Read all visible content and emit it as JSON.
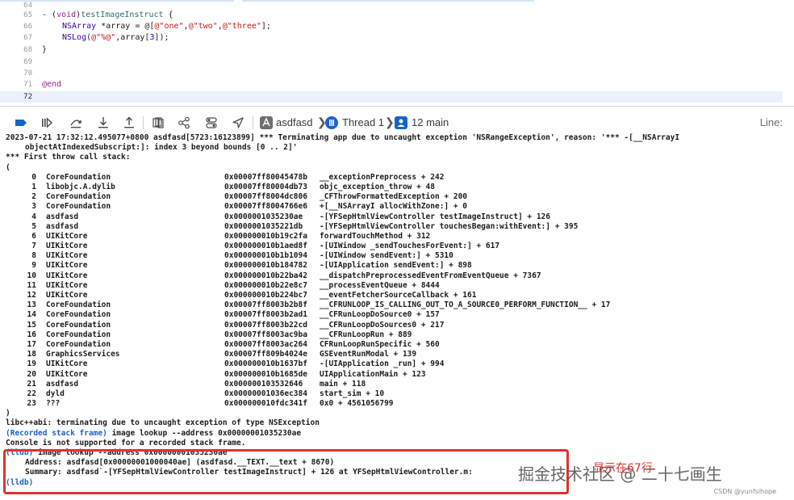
{
  "editor": {
    "lines": [
      {
        "num": "64"
      },
      {
        "num": "65"
      },
      {
        "num": "66"
      },
      {
        "num": "67"
      },
      {
        "num": "68"
      },
      {
        "num": "69"
      },
      {
        "num": "70"
      },
      {
        "num": "71"
      },
      {
        "num": "72"
      }
    ],
    "code": {
      "l65_dash": "- (",
      "l65_void": "void",
      "l65_rp": ")",
      "l65_fn": "testImageInstruct",
      "l65_brace": " {",
      "l66_type": "NSArray",
      "l66_mid": " *array = @[",
      "l66_s1": "@\"one\"",
      "l66_c1": ",",
      "l66_s2": "@\"two\"",
      "l66_c2": ",",
      "l66_s3": "@\"three\"",
      "l66_end": "];",
      "l67_fn": "NSLog",
      "l67_lp": "(",
      "l67_s": "@\"%@\"",
      "l67_mid": ",array[",
      "l67_num": "3",
      "l67_end": "]);",
      "l68": "}",
      "l71": "@end"
    }
  },
  "toolbar": {
    "target": "asdfasd",
    "thread": "Thread 1",
    "frame": "12 main",
    "line_label": "Line:",
    "icons": [
      "breakpoints-toggle-icon",
      "continue-icon",
      "step-over-icon",
      "step-into-icon",
      "step-out-icon",
      "debug-view-hierarchy-icon",
      "memory-graph-icon",
      "environment-overrides-icon",
      "simulate-location-icon"
    ]
  },
  "console": {
    "header1": "2023-07-21 17:32:12.495077+0800 asdfasd[5723:16123899] *** Terminating app due to uncaught exception 'NSRangeException', reason: '*** -[__NSArrayI",
    "header2": "objectAtIndexedSubscript:]: index 3 beyond bounds [0 .. 2]'",
    "header3": "*** First throw call stack:",
    "open": "(",
    "stack": [
      {
        "n": "0",
        "lib": "CoreFoundation",
        "addr": "0x00007ff80045478b",
        "sym": "__exceptionPreprocess + 242"
      },
      {
        "n": "1",
        "lib": "libobjc.A.dylib",
        "addr": "0x00007ff80004db73",
        "sym": "objc_exception_throw + 48"
      },
      {
        "n": "2",
        "lib": "CoreFoundation",
        "addr": "0x00007ff8004dc806",
        "sym": "_CFThrowFormattedException + 200"
      },
      {
        "n": "3",
        "lib": "CoreFoundation",
        "addr": "0x00007ff8004766e6",
        "sym": "+[__NSArrayI allocWithZone:] + 0"
      },
      {
        "n": "4",
        "lib": "asdfasd",
        "addr": "0x0000001035230ae",
        "sym": "-[YFSepHtmlViewController testImageInstruct] + 126"
      },
      {
        "n": "5",
        "lib": "asdfasd",
        "addr": "0x0000001035221db",
        "sym": "-[YFSepHtmlViewController touchesBegan:withEvent:] + 395"
      },
      {
        "n": "6",
        "lib": "UIKitCore",
        "addr": "0x000000010b19c2fa",
        "sym": "forwardTouchMethod + 312"
      },
      {
        "n": "7",
        "lib": "UIKitCore",
        "addr": "0x000000010b1aed8f",
        "sym": "-[UIWindow _sendTouchesForEvent:] + 617"
      },
      {
        "n": "8",
        "lib": "UIKitCore",
        "addr": "0x000000010b1b1094",
        "sym": "-[UIWindow sendEvent:] + 5310"
      },
      {
        "n": "9",
        "lib": "UIKitCore",
        "addr": "0x000000010b184782",
        "sym": "-[UIApplication sendEvent:] + 898"
      },
      {
        "n": "10",
        "lib": "UIKitCore",
        "addr": "0x000000010b22ba42",
        "sym": "__dispatchPreprocessedEventFromEventQueue + 7367"
      },
      {
        "n": "11",
        "lib": "UIKitCore",
        "addr": "0x000000010b22e8c7",
        "sym": "__processEventQueue + 8444"
      },
      {
        "n": "12",
        "lib": "UIKitCore",
        "addr": "0x000000010b224bc7",
        "sym": "__eventFetcherSourceCallback + 161"
      },
      {
        "n": "13",
        "lib": "CoreFoundation",
        "addr": "0x00007ff8003b2b8f",
        "sym": "__CFRUNLOOP_IS_CALLING_OUT_TO_A_SOURCE0_PERFORM_FUNCTION__ + 17"
      },
      {
        "n": "14",
        "lib": "CoreFoundation",
        "addr": "0x00007ff8003b2ad1",
        "sym": "__CFRunLoopDoSource0 + 157"
      },
      {
        "n": "15",
        "lib": "CoreFoundation",
        "addr": "0x00007ff8003b22cd",
        "sym": "__CFRunLoopDoSources0 + 217"
      },
      {
        "n": "16",
        "lib": "CoreFoundation",
        "addr": "0x00007ff8003ac9ba",
        "sym": "__CFRunLoopRun + 889"
      },
      {
        "n": "17",
        "lib": "CoreFoundation",
        "addr": "0x00007ff8003ac264",
        "sym": "CFRunLoopRunSpecific + 560"
      },
      {
        "n": "18",
        "lib": "GraphicsServices",
        "addr": "0x00007ff809b4024e",
        "sym": "GSEventRunModal + 139"
      },
      {
        "n": "19",
        "lib": "UIKitCore",
        "addr": "0x000000010b1637bf",
        "sym": "-[UIApplication _run] + 994"
      },
      {
        "n": "20",
        "lib": "UIKitCore",
        "addr": "0x000000010b1685de",
        "sym": "UIApplicationMain + 123"
      },
      {
        "n": "21",
        "lib": "asdfasd",
        "addr": "0x000000103532646",
        "sym": "main + 118"
      },
      {
        "n": "22",
        "lib": "dyld",
        "addr": "0x00000001036ec384",
        "sym": "start_sim + 10"
      },
      {
        "n": "23",
        "lib": "???",
        "addr": "0x000000010fdc341f",
        "sym": "0x0 + 4561056799"
      }
    ],
    "close": ")",
    "libcpp": "libc++abi: terminating due to uncaught exception of type NSException",
    "recorded_tag": "(Recorded stack frame)",
    "recorded_cmd": " image lookup --address 0x00000001035230ae",
    "not_supported": "Console is not supported for a recorded stack frame.",
    "lldb_tag": "(lldb)",
    "lldb_cmd": " image lookup --address 0x00000001035230ae",
    "address_line": "Address: asdfasd[0x00000001000040ae] (asdfasd.__TEXT.__text + 8670)",
    "summary_line": "Summary: asdfasd`-[YFSepHtmlViewController testImageInstruct] + 126 at YFSepHtmlViewController.m:",
    "prompt": "(lldb)"
  },
  "watermark": {
    "main": "掘金技术社区 @ 二十七画生",
    "red": "显示在67行",
    "small": "CSDN @yunfsihope"
  },
  "colors": {
    "accent_blue": "#1a63c6",
    "highlight_red": "#e0332f",
    "current_line": "#eaf1fb"
  }
}
